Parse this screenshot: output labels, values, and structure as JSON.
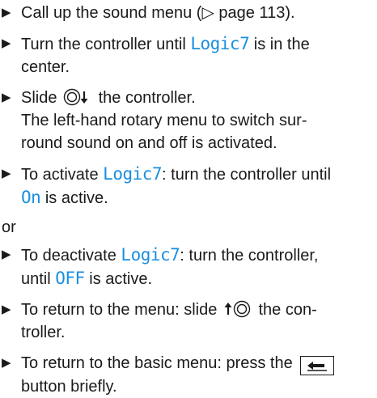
{
  "steps": [
    {
      "pre": "Call up the sound menu (",
      "ref_symbol": "▷",
      "ref_text": " page 113)."
    },
    {
      "pre": "Turn the controller until ",
      "term": "Logic7",
      "post": " is in the",
      "line2": "center."
    },
    {
      "pre": "Slide ",
      "post": " the controller.",
      "line2": "The left-hand rotary menu to switch sur-",
      "line3": "round sound on and off is activated."
    },
    {
      "pre": "To activate ",
      "term": "Logic7",
      "mid": ": turn the controller until",
      "term2": "On",
      "post": " is active."
    },
    {
      "pre": "To deactivate ",
      "term": "Logic7",
      "mid": ": turn the controller,",
      "line2_pre": "until ",
      "term2": "OFF",
      "post": " is active."
    },
    {
      "pre": "To return to the menu: slide ",
      "post": " the con-",
      "line2": "troller."
    },
    {
      "pre": "To return to the basic menu: press the ",
      "line2": "button briefly."
    }
  ],
  "or_text": "or",
  "bullet_symbol": "▶",
  "accent_color": "#1a8fe0",
  "icons": {
    "slide_down": "controller-slide-down-icon",
    "slide_up": "controller-slide-up-icon",
    "back_button": "back-button-icon"
  }
}
